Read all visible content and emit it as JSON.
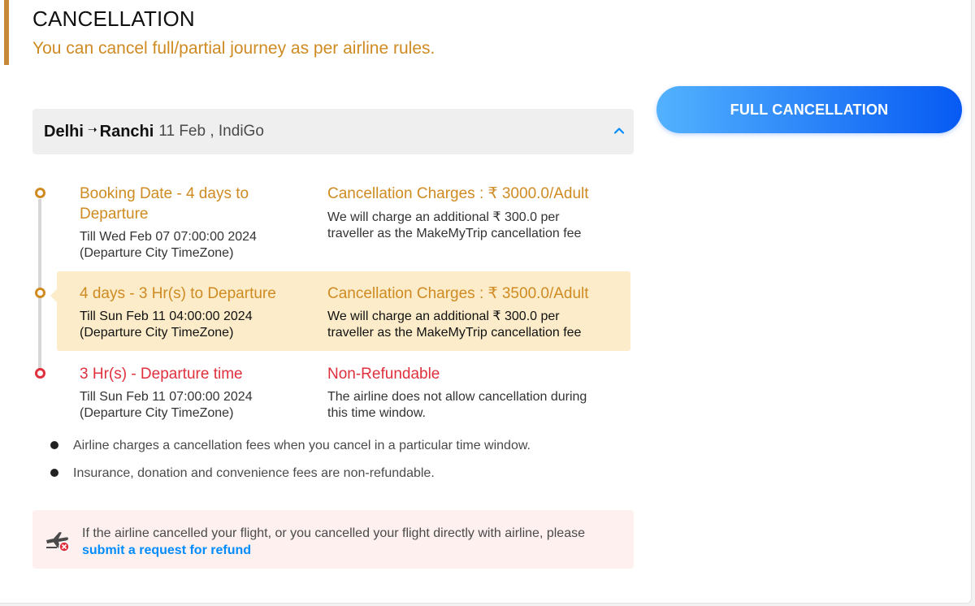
{
  "section": {
    "title": "CANCELLATION",
    "subtitle": "You can cancel full/partial journey as per airline rules."
  },
  "actions": {
    "full_cancellation_label": "FULL CANCELLATION"
  },
  "flight": {
    "from": "Delhi",
    "to": "Ranchi",
    "arrow": "➝",
    "meta": "11 Feb , IndiGo",
    "expanded": true
  },
  "slots": [
    {
      "title": "Booking Date - 4 days to Departure",
      "till": "Till Wed Feb 07 07:00:00 2024",
      "timezone": "(Departure City TimeZone)",
      "charge_title": "Cancellation Charges : ₹ 3000.0/Adult",
      "charge_desc": "We will charge an additional ₹ 300.0 per traveller as the MakeMyTrip cancellation fee",
      "status": "upcoming"
    },
    {
      "title": "4 days - 3 Hr(s) to Departure",
      "till": "Till Sun Feb 11 04:00:00 2024",
      "timezone": "(Departure City TimeZone)",
      "charge_title": "Cancellation Charges : ₹ 3500.0/Adult",
      "charge_desc": "We will charge an additional ₹ 300.0 per traveller as the MakeMyTrip cancellation fee",
      "status": "current"
    },
    {
      "title": "3 Hr(s) - Departure time",
      "till": "Till Sun Feb 11 07:00:00 2024",
      "timezone": "(Departure City TimeZone)",
      "charge_title": "Non-Refundable",
      "charge_desc": "The airline does not allow cancellation during this time window.",
      "status": "non-refundable"
    }
  ],
  "notes": [
    "Airline charges a cancellation fees when you cancel in a particular time window.",
    "Insurance, donation and convenience fees are non-refundable."
  ],
  "refund": {
    "text": "If the airline cancelled your flight, or you cancelled your flight directly with airline, please",
    "link": "submit a request for refund"
  },
  "colors": {
    "accent": "#cf8b22",
    "danger": "#e0303d",
    "link": "#008cff",
    "button_start": "#53b2fe",
    "button_end": "#065af3",
    "highlight": "#fcecc9"
  }
}
